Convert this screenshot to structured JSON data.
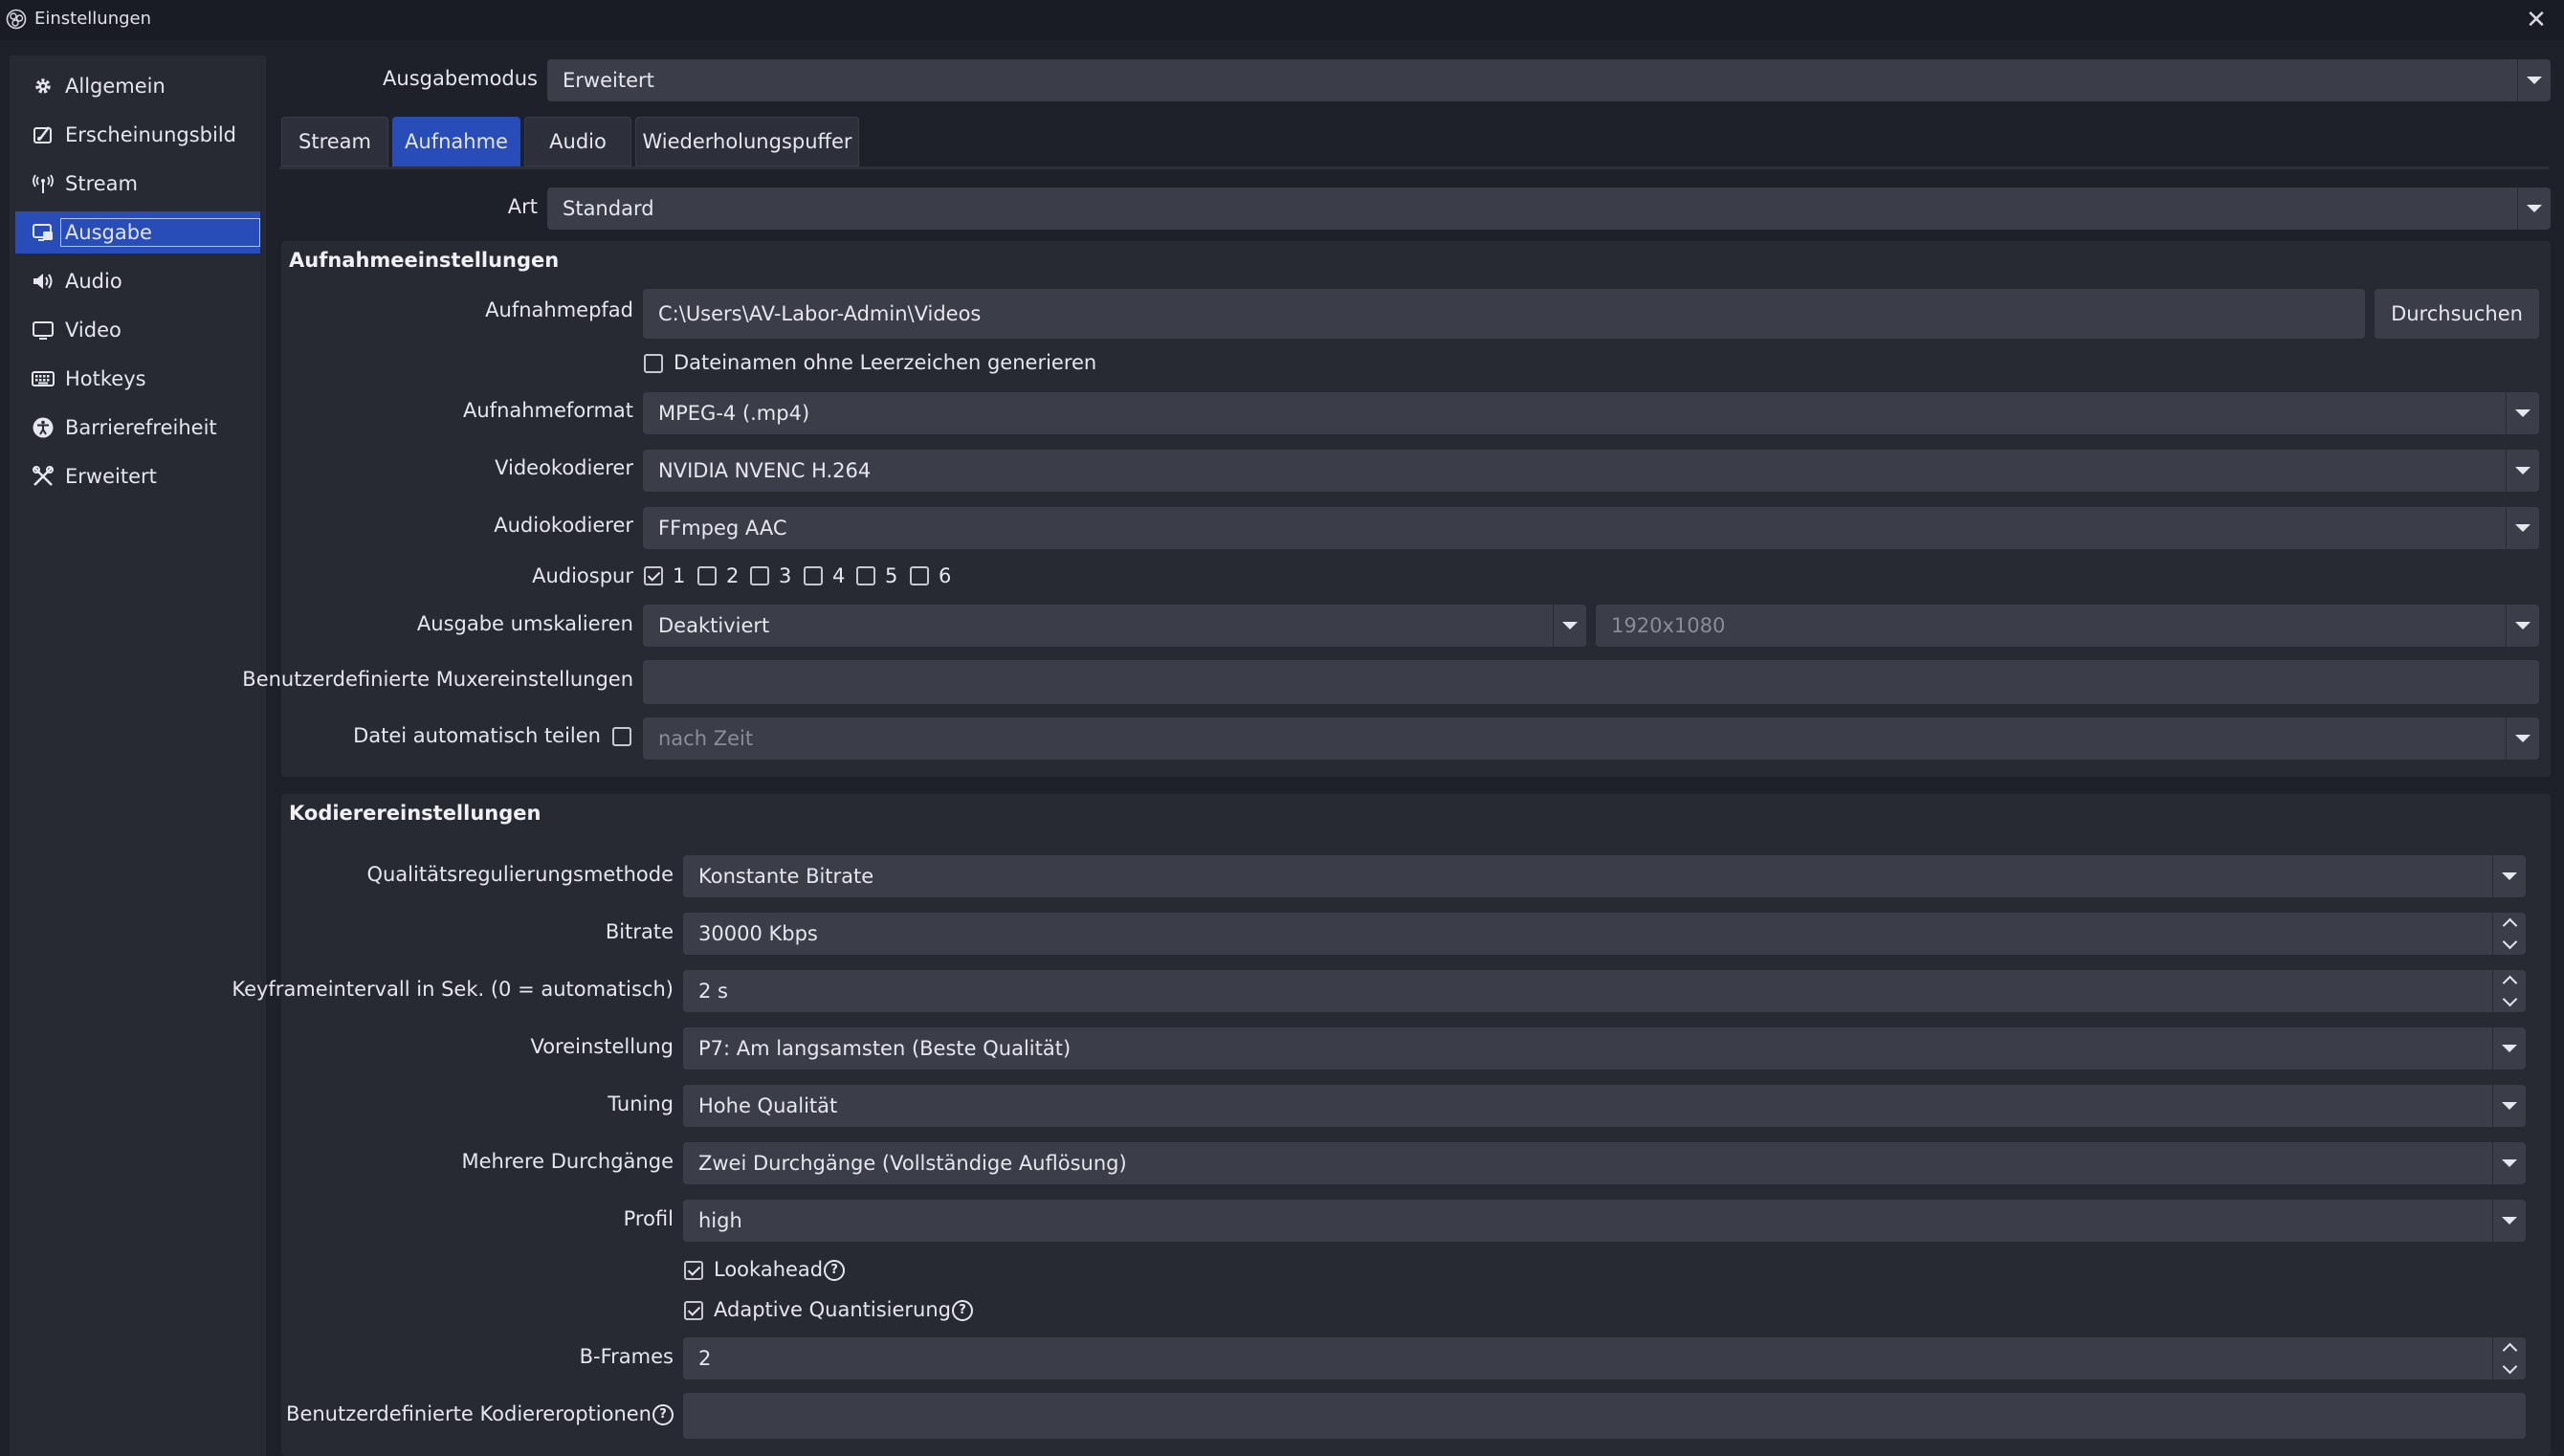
{
  "window": {
    "title": "Einstellungen"
  },
  "sidebar": {
    "items": [
      {
        "label": "Allgemein",
        "icon": "gear-icon"
      },
      {
        "label": "Erscheinungsbild",
        "icon": "appearance-icon"
      },
      {
        "label": "Stream",
        "icon": "antenna-icon"
      },
      {
        "label": "Ausgabe",
        "icon": "output-icon",
        "active": true
      },
      {
        "label": "Audio",
        "icon": "speaker-icon"
      },
      {
        "label": "Video",
        "icon": "monitor-icon"
      },
      {
        "label": "Hotkeys",
        "icon": "keyboard-icon"
      },
      {
        "label": "Barrierefreiheit",
        "icon": "accessibility-icon"
      },
      {
        "label": "Erweitert",
        "icon": "tools-icon"
      }
    ]
  },
  "output_mode": {
    "label": "Ausgabemodus",
    "value": "Erweitert"
  },
  "tabs": [
    {
      "label": "Stream"
    },
    {
      "label": "Aufnahme",
      "active": true
    },
    {
      "label": "Audio"
    },
    {
      "label": "Wiederholungspuffer"
    }
  ],
  "type": {
    "label": "Art",
    "value": "Standard"
  },
  "recording": {
    "title": "Aufnahmeeinstellungen",
    "path_label": "Aufnahmepfad",
    "path_value": "C:\\Users\\AV-Labor-Admin\\Videos",
    "browse_label": "Durchsuchen",
    "no_space_label": "Dateinamen ohne Leerzeichen generieren",
    "format_label": "Aufnahmeformat",
    "format_value": "MPEG-4 (.mp4)",
    "video_encoder_label": "Videokodierer",
    "video_encoder_value": "NVIDIA NVENC H.264",
    "audio_encoder_label": "Audiokodierer",
    "audio_encoder_value": "FFmpeg AAC",
    "audio_track_label": "Audiospur",
    "tracks": [
      {
        "label": "1",
        "checked": true
      },
      {
        "label": "2",
        "checked": false
      },
      {
        "label": "3",
        "checked": false
      },
      {
        "label": "4",
        "checked": false
      },
      {
        "label": "5",
        "checked": false
      },
      {
        "label": "6",
        "checked": false
      }
    ],
    "rescale_label": "Ausgabe umskalieren",
    "rescale_value": "Deaktiviert",
    "rescale_resolution": "1920x1080",
    "mux_label": "Benutzerdefinierte Muxereinstellungen",
    "mux_value": "",
    "split_label": "Datei automatisch teilen",
    "split_value": "nach Zeit"
  },
  "encoder": {
    "title": "Kodierereinstellungen",
    "rate_control_label": "Qualitätsregulierungsmethode",
    "rate_control_value": "Konstante Bitrate",
    "bitrate_label": "Bitrate",
    "bitrate_value": "30000 Kbps",
    "keyframe_label": "Keyframeintervall in Sek. (0 = automatisch)",
    "keyframe_value": "2 s",
    "preset_label": "Voreinstellung",
    "preset_value": "P7: Am langsamsten (Beste Qualität)",
    "tuning_label": "Tuning",
    "tuning_value": "Hohe Qualität",
    "multipass_label": "Mehrere Durchgänge",
    "multipass_value": "Zwei Durchgänge (Vollständige Auflösung)",
    "profile_label": "Profil",
    "profile_value": "high",
    "lookahead_label": "Lookahead",
    "aq_label": "Adaptive Quantisierung",
    "bframes_label": "B-Frames",
    "bframes_value": "2",
    "custom_opts_label": "Benutzerdefinierte Kodiereroptionen",
    "custom_opts_value": ""
  },
  "colors": {
    "accent": "#284cb8",
    "background": "#1e202a",
    "panel": "#272a33",
    "field": "#3b3e48"
  }
}
